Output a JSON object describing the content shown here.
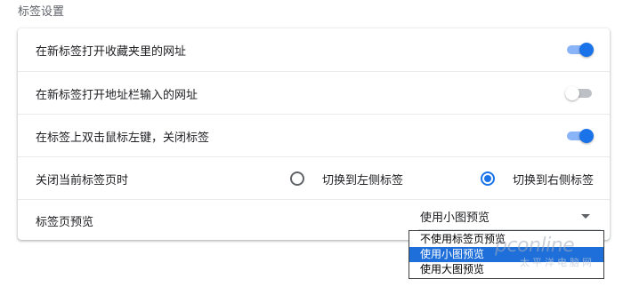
{
  "section": {
    "title": "标签设置"
  },
  "settings": [
    {
      "label": "在新标签打开收藏夹里的网址",
      "toggle": "on"
    },
    {
      "label": "在新标签打开地址栏输入的网址",
      "toggle": "off"
    },
    {
      "label": "在标签上双击鼠标左键，关闭标签",
      "toggle": "on"
    }
  ],
  "close_tab": {
    "label": "关闭当前标签页时",
    "options": [
      {
        "label": "切换到左侧标签",
        "checked": false
      },
      {
        "label": "切换到右侧标签",
        "checked": true
      }
    ]
  },
  "preview": {
    "label": "标签页预览",
    "selected_value": "使用小图预览",
    "options": [
      {
        "label": "不使用标签页预览",
        "selected": false
      },
      {
        "label": "使用小图预览",
        "selected": true
      },
      {
        "label": "使用大图预览",
        "selected": false
      }
    ]
  },
  "watermark": {
    "brand": "pconline",
    "sub": "太平洋电脑网"
  },
  "colors": {
    "accent": "#1a73e8",
    "accent_light": "#8ab4f8",
    "selection": "#1e6fd9"
  }
}
